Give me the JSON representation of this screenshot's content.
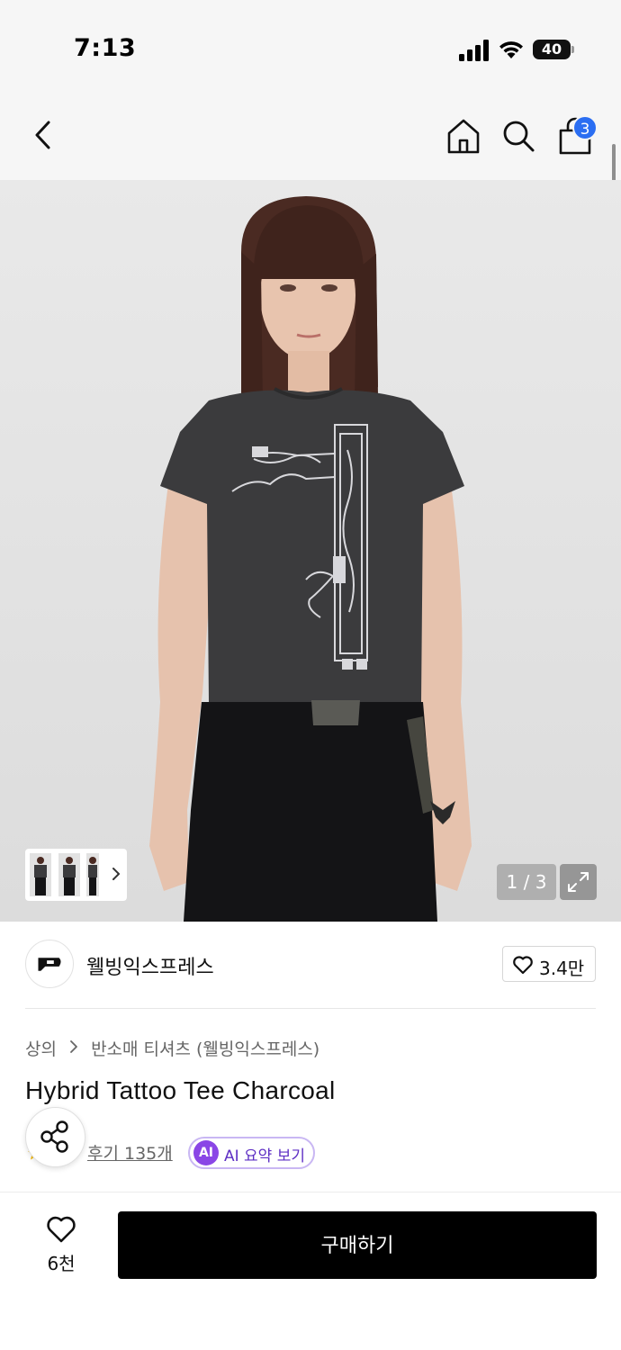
{
  "status_bar": {
    "time": "7:13",
    "battery": "40"
  },
  "nav": {
    "cart_count": "3"
  },
  "gallery": {
    "page_indicator": "1 / 3"
  },
  "brand": {
    "name": "웰빙익스프레스",
    "like_count": "3.4만"
  },
  "breadcrumb": {
    "category": "상의",
    "subcategory": "반소매 티셔츠 (웰빙익스프레스)"
  },
  "product": {
    "title": "Hybrid Tattoo Tee Charcoal"
  },
  "reviews": {
    "link_text": "후기 135개",
    "ai_badge": "AI",
    "ai_summary_label": "AI 요약 보기"
  },
  "bottom_bar": {
    "wish_count": "6천",
    "buy_label": "구매하기"
  },
  "colors": {
    "accent_blue": "#2b6ef2",
    "ai_purple": "#8a46e6",
    "buy_button": "#000000"
  }
}
